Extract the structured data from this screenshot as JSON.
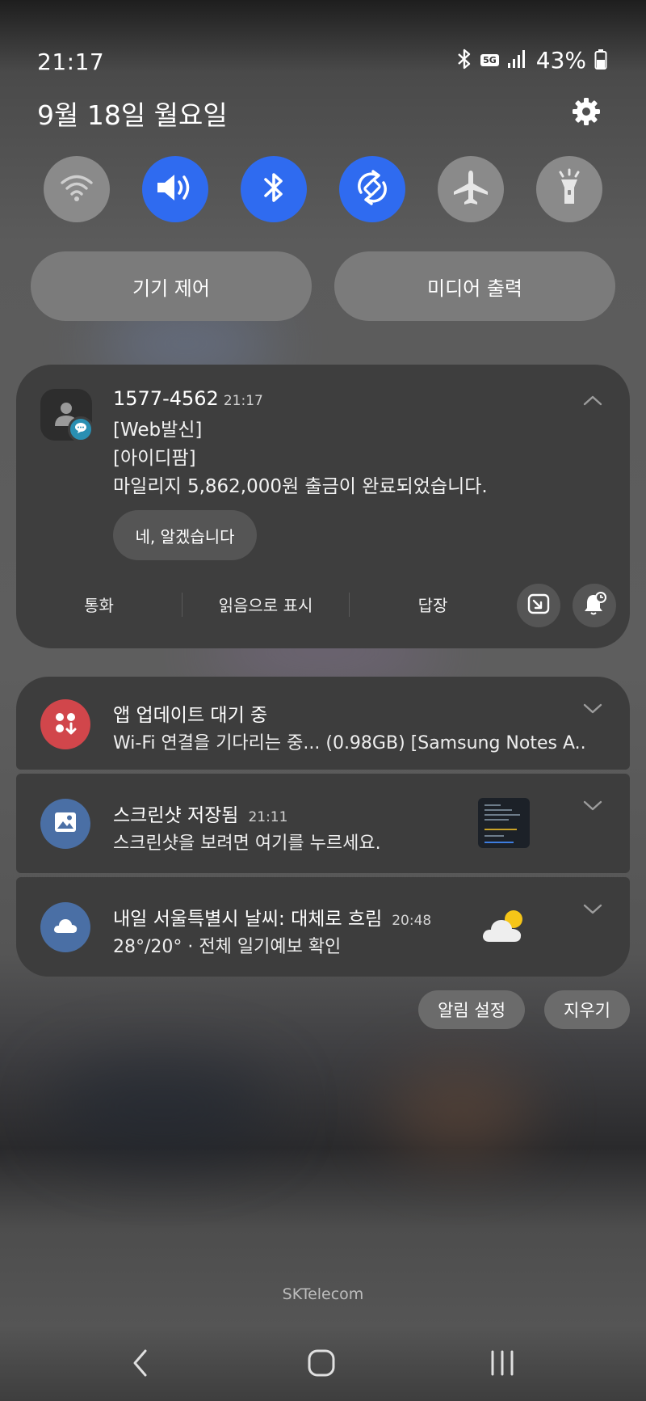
{
  "status_bar": {
    "time": "21:17",
    "network": "5G",
    "battery": "43%"
  },
  "header": {
    "date": "9월 18일 월요일"
  },
  "quick_settings": [
    {
      "name": "wifi",
      "active": false
    },
    {
      "name": "sound",
      "active": true
    },
    {
      "name": "bluetooth",
      "active": true
    },
    {
      "name": "auto-rotate",
      "active": true
    },
    {
      "name": "airplane-mode",
      "active": false
    },
    {
      "name": "flashlight",
      "active": false
    }
  ],
  "panel_buttons": {
    "device_control": "기기 제어",
    "media_output": "미디어 출력"
  },
  "message_notification": {
    "sender": "1577-4562",
    "time": "21:17",
    "lines": [
      "[Web발신]",
      "[아이디팜]",
      "마일리지 5,862,000원 출금이 완료되었습니다."
    ],
    "smart_reply": "네, 알겠습니다",
    "actions": {
      "call": "통화",
      "mark_read": "읽음으로 표시",
      "reply": "답장"
    }
  },
  "notifications": {
    "app_update": {
      "title": "앱 업데이트 대기 중",
      "text": "Wi-Fi 연결을 기다리는 중... (0.98GB) [Samsung Notes A..",
      "icon_color": "#d1464b"
    },
    "screenshot": {
      "title": "스크린샷 저장됨",
      "time": "21:11",
      "text": "스크린샷을 보려면 여기를 누르세요.",
      "icon_color": "#4a6fa5"
    },
    "weather": {
      "title": "내일 서울특별시 날씨: 대체로 흐림",
      "time": "20:48",
      "text": "28°/20° · 전체 일기예보 확인",
      "icon_color": "#4a6fa5"
    }
  },
  "footer": {
    "notification_settings": "알림 설정",
    "clear": "지우기"
  },
  "carrier": "SKTelecom",
  "colors": {
    "active_tile": "#2f6bf0",
    "card_bg": "#3d3d3d"
  }
}
